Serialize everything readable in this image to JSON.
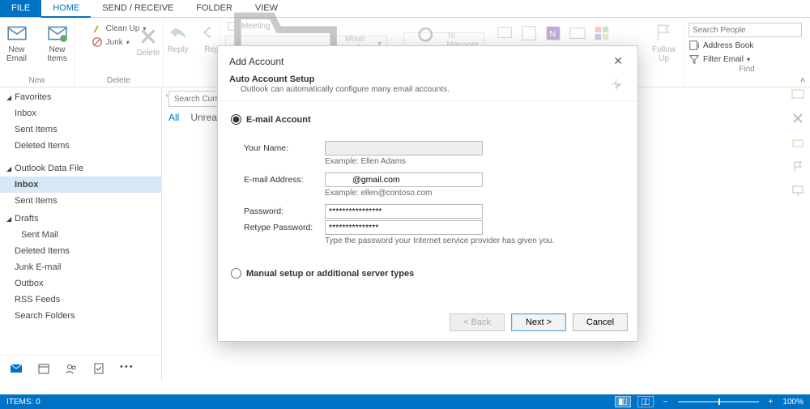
{
  "tabs": {
    "file": "FILE",
    "home": "HOME",
    "send_receive": "SEND / RECEIVE",
    "folder": "FOLDER",
    "view": "VIEW"
  },
  "ribbon": {
    "new_email": "New\nEmail",
    "new_items": "New\nItems",
    "group_new": "New",
    "cleanup": "Clean Up",
    "junk": "Junk",
    "delete": "Delete",
    "group_delete": "Delete",
    "reply": "Reply",
    "reply_all": "Rep",
    "meeting": "Meeting",
    "move_to": "Move to: ?",
    "to_manager": "To Manager",
    "follow_up": "Follow\nUp",
    "search_people_ph": "Search People",
    "address_book": "Address Book",
    "filter_email": "Filter Email",
    "group_find": "Find"
  },
  "nav": {
    "favorites": "Favorites",
    "fav_items": [
      "Inbox",
      "Sent Items",
      "Deleted Items"
    ],
    "data_file": "Outlook Data File",
    "inbox": "Inbox",
    "sent_items": "Sent Items",
    "drafts": "Drafts",
    "sent_mail": "Sent Mail",
    "rest": [
      "Deleted Items",
      "Junk E-mail",
      "Outbox",
      "RSS Feeds",
      "Search Folders"
    ]
  },
  "content": {
    "search_ph": "Search Curren",
    "filter_all": "All",
    "filter_unread": "Unrea"
  },
  "dialog": {
    "title": "Add Account",
    "heading": "Auto Account Setup",
    "subheading": "Outlook can automatically configure many email accounts.",
    "opt_email": "E-mail Account",
    "opt_manual": "Manual setup or additional server types",
    "name_label": "Your Name:",
    "name_value": "",
    "name_hint": "Example: Ellen Adams",
    "email_label": "E-mail Address:",
    "email_value": "          @gmail.com",
    "email_hint": "Example: ellen@contoso.com",
    "pw_label": "Password:",
    "pw_value": "****************",
    "pw2_label": "Retype Password:",
    "pw2_value": "***************",
    "pw_hint": "Type the password your Internet service provider has given you.",
    "btn_back": "< Back",
    "btn_next": "Next >",
    "btn_cancel": "Cancel"
  },
  "status": {
    "items": "ITEMS: 0",
    "zoom": "100%"
  }
}
